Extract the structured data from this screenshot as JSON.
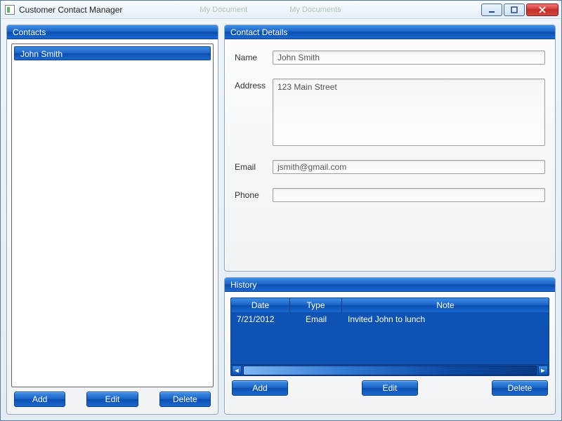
{
  "window": {
    "title": "Customer Contact Manager",
    "faint1": "My Document",
    "faint2": "My Documents"
  },
  "contacts": {
    "header": "Contacts",
    "items": [
      {
        "name": "John Smith"
      }
    ],
    "buttons": {
      "add": "Add",
      "edit": "Edit",
      "delete": "Delete"
    }
  },
  "details": {
    "header": "Contact Details",
    "labels": {
      "name": "Name",
      "address": "Address",
      "email": "Email",
      "phone": "Phone"
    },
    "values": {
      "name": "John Smith",
      "address": "123 Main Street",
      "email": "jsmith@gmail.com",
      "phone": ""
    }
  },
  "history": {
    "header": "History",
    "columns": {
      "date": "Date",
      "type": "Type",
      "note": "Note"
    },
    "rows": [
      {
        "date": "7/21/2012",
        "type": "Email",
        "note": "Invited John to lunch"
      }
    ],
    "buttons": {
      "add": "Add",
      "edit": "Edit",
      "delete": "Delete"
    }
  }
}
